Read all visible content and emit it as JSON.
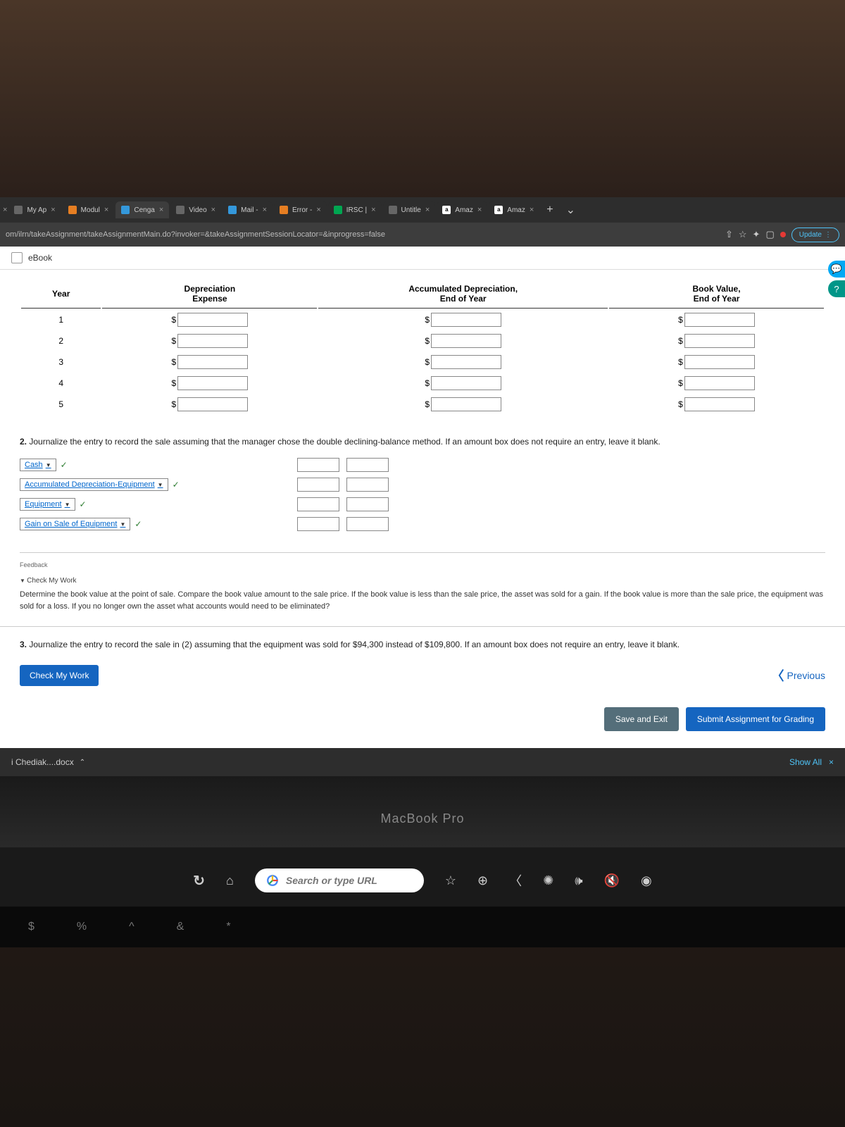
{
  "tabs": [
    {
      "label": "My Ap"
    },
    {
      "label": "Modul"
    },
    {
      "label": "Cenga"
    },
    {
      "label": "Video"
    },
    {
      "label": "Mail -"
    },
    {
      "label": "Error -"
    },
    {
      "label": "IRSC |"
    },
    {
      "label": "Untitle"
    },
    {
      "label": "Amaz"
    },
    {
      "label": "Amaz"
    }
  ],
  "url": "om/ilrn/takeAssignment/takeAssignmentMain.do?invoker=&takeAssignmentSessionLocator=&inprogress=false",
  "update_label": "Update",
  "ebook_label": "eBook",
  "table": {
    "headers": {
      "year": "Year",
      "dep1": "Depreciation",
      "dep2": "Expense",
      "acc1": "Accumulated Depreciation,",
      "acc2": "End of Year",
      "bv1": "Book Value,",
      "bv2": "End of Year"
    },
    "years": [
      "1",
      "2",
      "3",
      "4",
      "5"
    ]
  },
  "q2": {
    "num": "2.",
    "text": "Journalize the entry to record the sale assuming that the manager chose the double declining-balance method. If an amount box does not require an entry, leave it blank."
  },
  "journal_accounts": [
    "Cash",
    "Accumulated Depreciation-Equipment",
    "Equipment",
    "Gain on Sale of Equipment"
  ],
  "feedback": {
    "label": "Feedback",
    "toggle": "Check My Work",
    "text": "Determine the book value at the point of sale. Compare the book value amount to the sale price. If the book value is less than the sale price, the asset was sold for a gain. If the book value is more than the sale price, the equipment was sold for a loss. If you no longer own the asset what accounts would need to be eliminated?"
  },
  "q3": {
    "num": "3.",
    "text": "Journalize the entry to record the sale in (2) assuming that the equipment was sold for $94,300 instead of $109,800. If an amount box does not require an entry, leave it blank."
  },
  "buttons": {
    "check_work": "Check My Work",
    "previous": "Previous",
    "save_exit": "Save and Exit",
    "submit": "Submit Assignment for Grading"
  },
  "downloads": {
    "file": "i Chediak....docx",
    "show_all": "Show All"
  },
  "macbook": "MacBook Pro",
  "search_placeholder": "Search or type URL",
  "kbd": {
    "dollar": "$",
    "percent": "%",
    "caret": "^",
    "amp": "&",
    "star": "*"
  }
}
